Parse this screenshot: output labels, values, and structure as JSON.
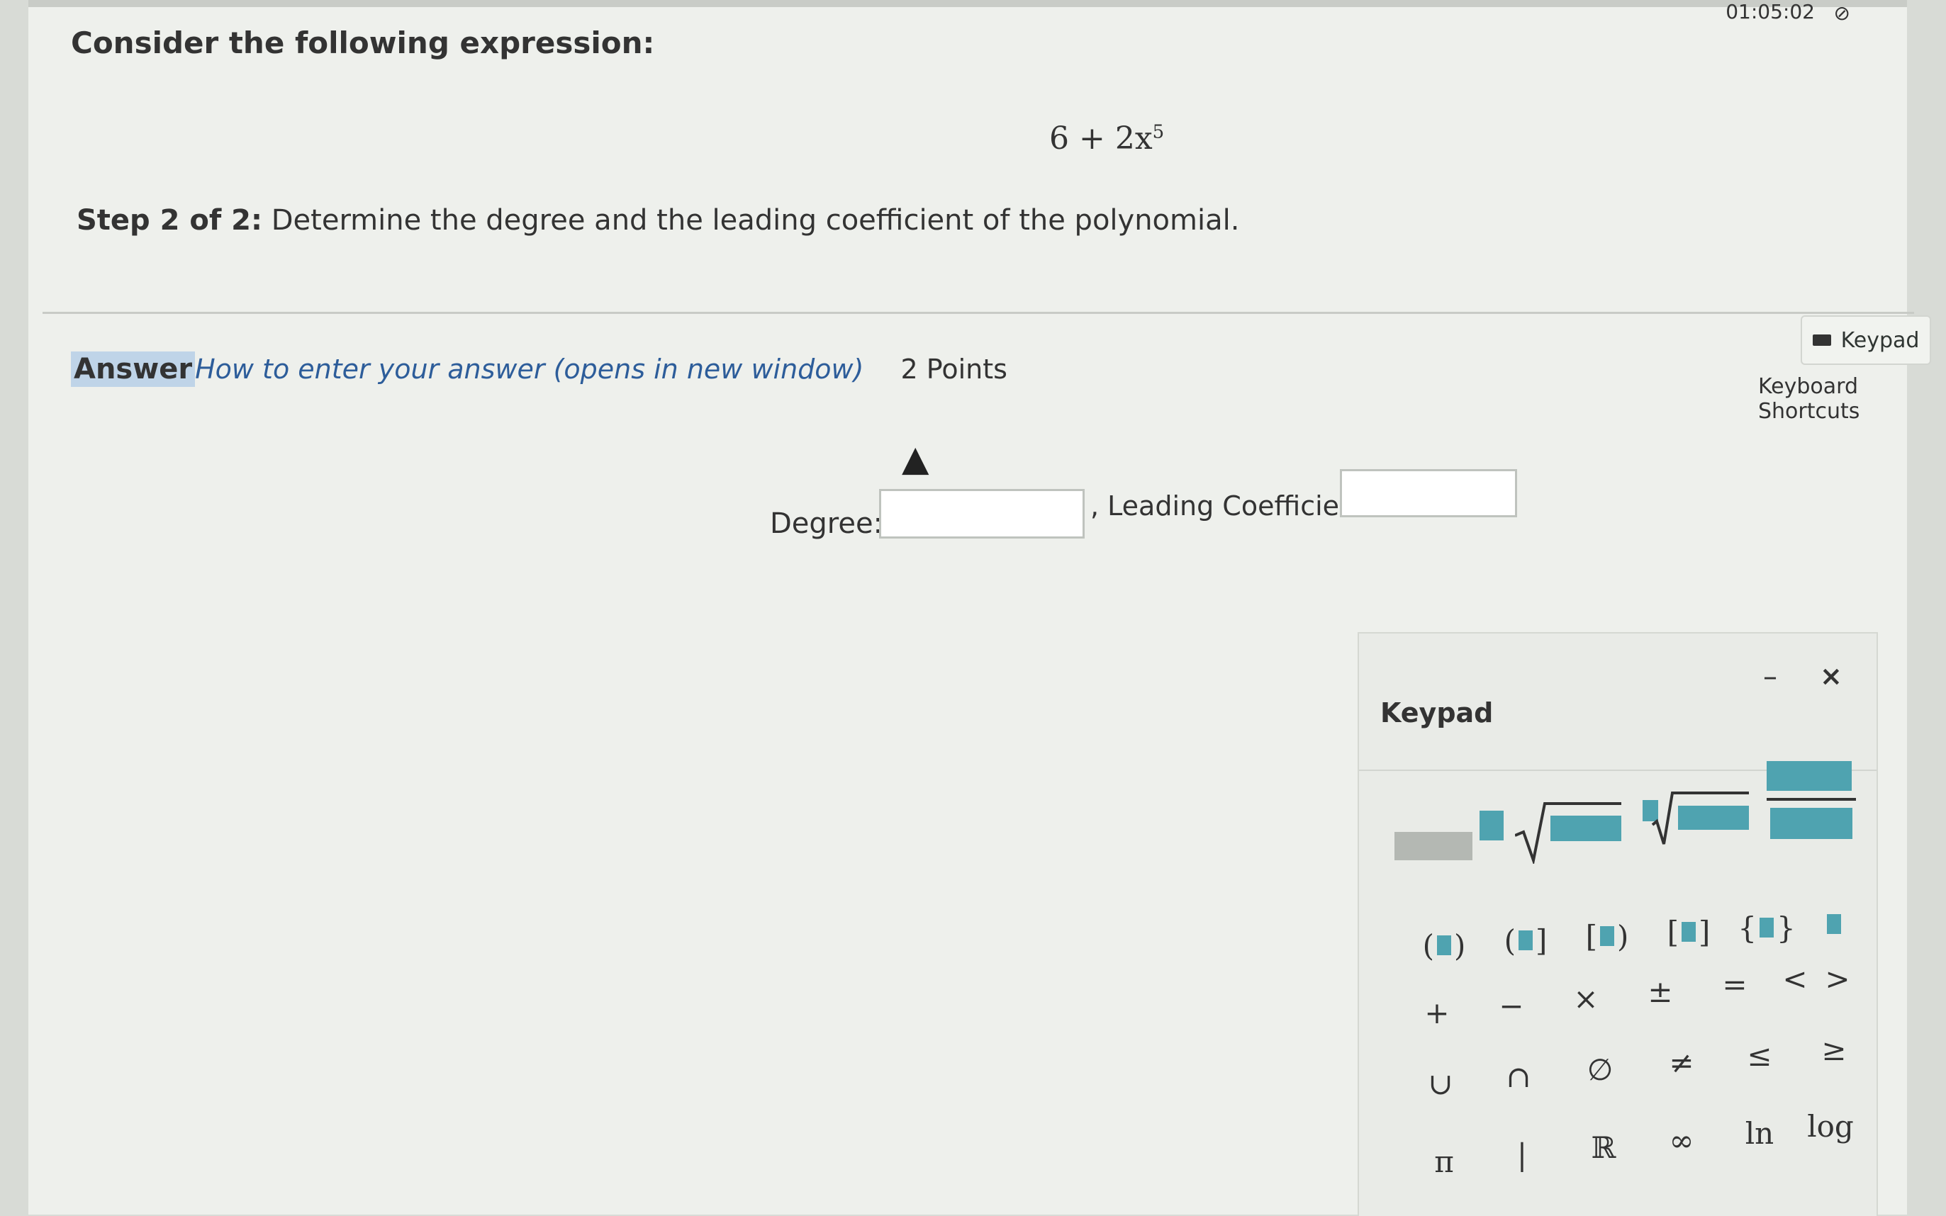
{
  "timer": "01:05:02",
  "question": {
    "prompt": "Consider the following expression:",
    "expression_base": "6 + 2x",
    "expression_exp": "5",
    "step_label": "Step 2 of 2:",
    "step_text": "Determine the degree and the leading coefficient of the polynomial."
  },
  "answer": {
    "label": "Answer",
    "howto_link": "How to enter your answer (opens in new window)",
    "points": "2 Points",
    "keypad_button": "Keypad",
    "keyboard_shortcuts": "Keyboard Shortcuts",
    "degree_label": "Degree:",
    "leading_label": ", Leading Coefficient:"
  },
  "keypad": {
    "title": "Keypad",
    "minimize": "–",
    "close": "×",
    "row_ops": [
      "+",
      "−",
      "×",
      "±",
      "=",
      "<",
      ">"
    ],
    "row_sets": [
      "∪",
      "∩",
      "∅",
      "≠",
      "≤",
      "≥"
    ],
    "row_misc": [
      "π",
      "|",
      "ℝ",
      "∞",
      "ln",
      "log"
    ]
  },
  "colors": {
    "placeholder_teal": "#4fa3b0",
    "answer_highlight": "#bfd4e8"
  }
}
